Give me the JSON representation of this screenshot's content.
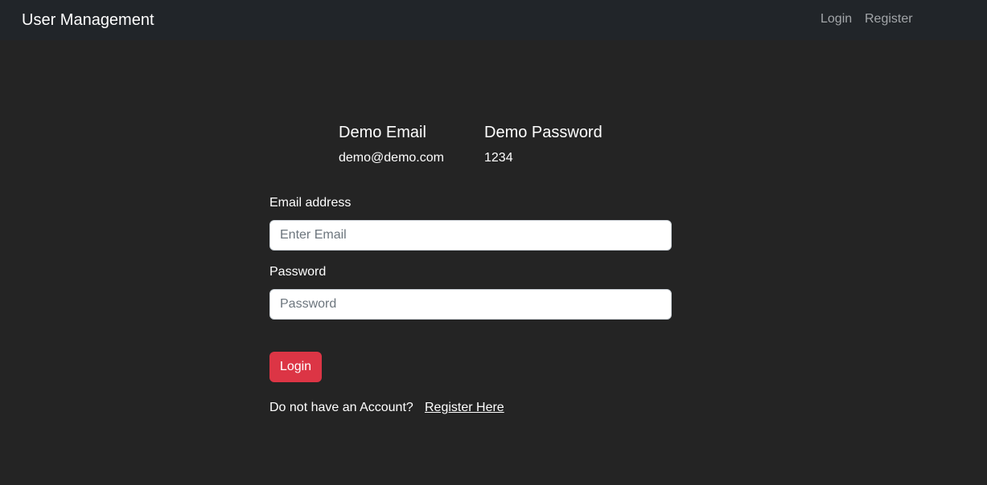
{
  "navbar": {
    "brand": "User Management",
    "links": [
      "Login",
      "Register"
    ]
  },
  "demo": {
    "email_heading": "Demo Email",
    "password_heading": "Demo Password",
    "email_value": "demo@demo.com",
    "password_value": "1234"
  },
  "form": {
    "email_label": "Email address",
    "email_placeholder": "Enter Email",
    "email_value": "",
    "password_label": "Password",
    "password_placeholder": "Password",
    "password_value": "",
    "submit_label": "Login"
  },
  "footer": {
    "prompt": "Do not have an Account?",
    "link": "Register Here"
  },
  "colors": {
    "page_background": "#242424",
    "navbar_background": "#212529",
    "nav_link": "#a3a6a9",
    "primary_button": "#dc3545"
  }
}
